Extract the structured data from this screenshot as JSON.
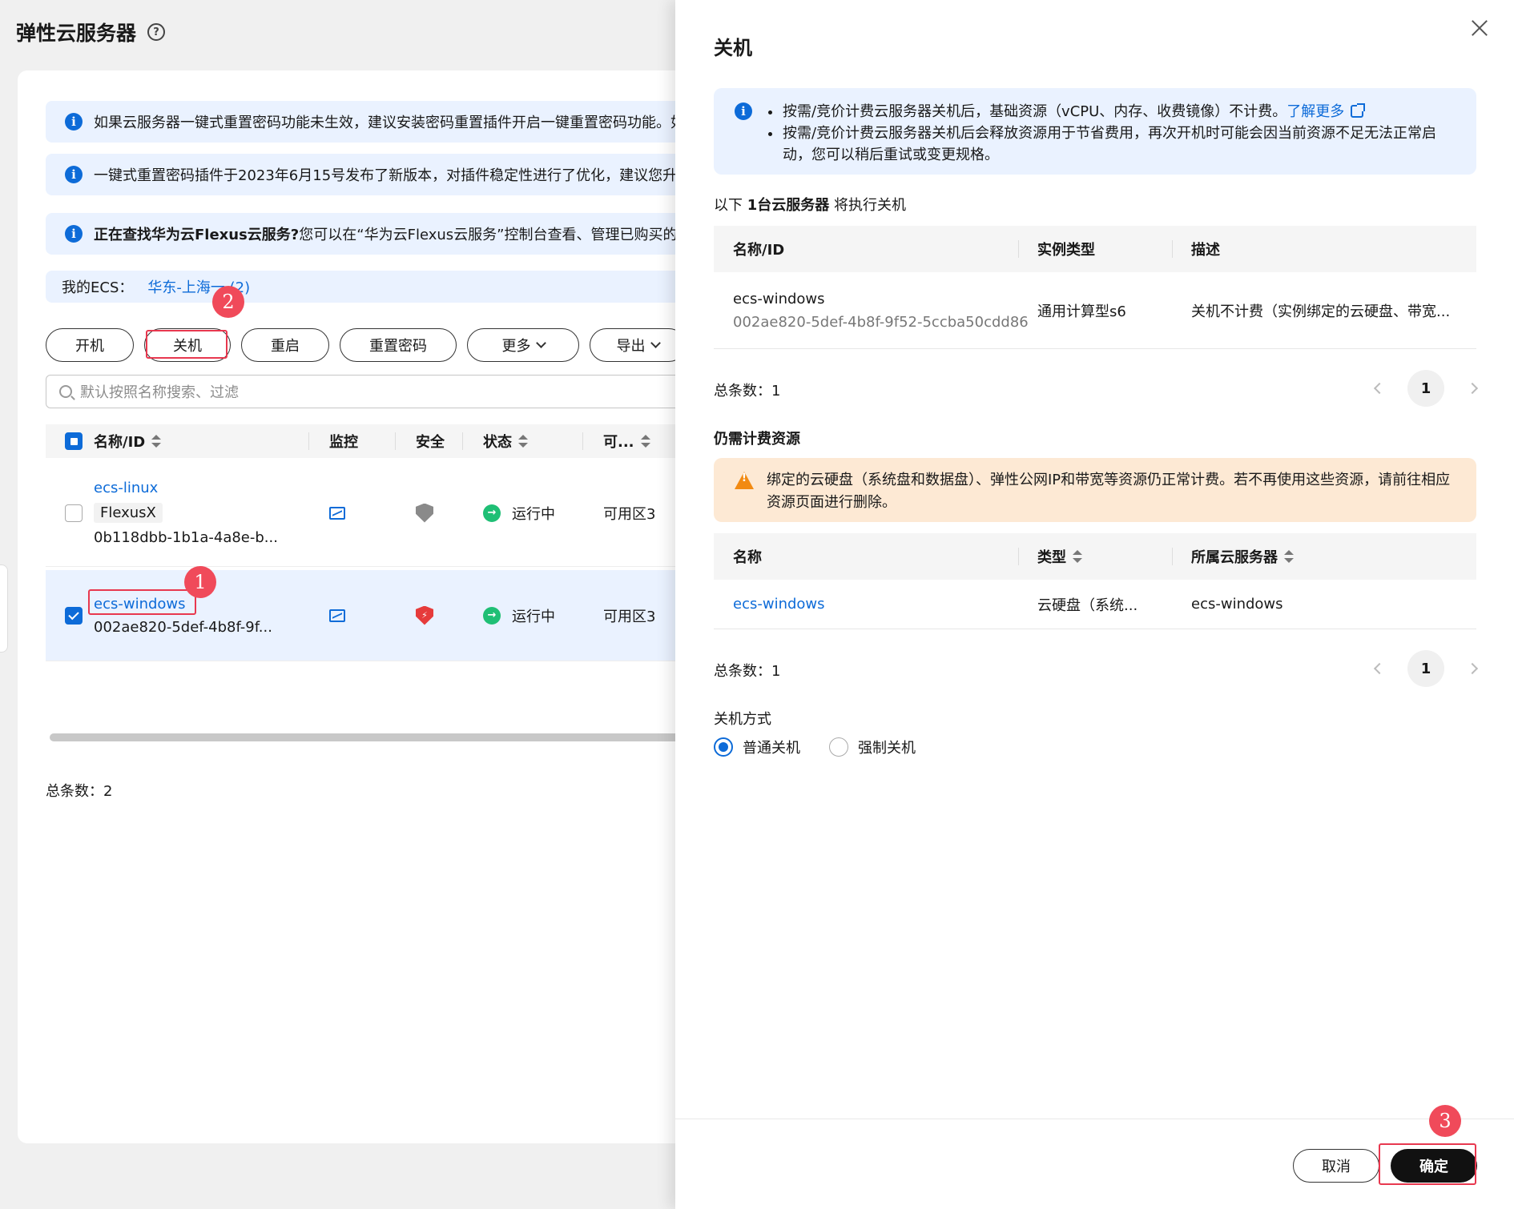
{
  "page": {
    "title": "弹性云服务器",
    "alerts": [
      {
        "text": "如果云服务器一键式重置密码功能未生效，建议安装密码重置插件开启一键重置密码功能。如"
      },
      {
        "text": "一键式重置密码插件于2023年6月15号发布了新版本，对插件稳定性进行了优化，建议您升级"
      },
      {
        "bold": "正在查找华为云Flexus云服务?",
        "text": " 您可以在“华为云Flexus云服务”控制台查看、管理已购买的L"
      }
    ],
    "region": {
      "label": "我的ECS：",
      "value": "华东-上海一 (2)"
    },
    "toolbar": {
      "start": "开机",
      "stop": "关机",
      "restart": "重启",
      "reset_pwd": "重置密码",
      "more": "更多",
      "export": "导出"
    },
    "search": {
      "placeholder": "默认按照名称搜索、过滤"
    },
    "columns": {
      "name": "名称/ID",
      "monitor": "监控",
      "security": "安全",
      "status": "状态",
      "az": "可..."
    },
    "rows": [
      {
        "name": "ecs-linux",
        "tag": "FlexusX",
        "id": "0b118dbb-1b1a-4a8e-b...",
        "status": "运行中",
        "az": "可用区3"
      },
      {
        "name": "ecs-windows",
        "id": "002ae820-5def-4b8f-9f...",
        "status": "运行中",
        "az": "可用区3"
      }
    ],
    "total": "总条数：2"
  },
  "drawer": {
    "title": "关机",
    "info_items": [
      {
        "text": "按需/竞价计费云服务器关机后，基础资源（vCPU、内存、收费镜像）不计费。",
        "link": "了解更多"
      },
      {
        "text": "按需/竞价计费云服务器关机后会释放资源用于节省费用，再次开机时可能会因当前资源不足无法正常启动，您可以稍后重试或变更规格。"
      }
    ],
    "summary": {
      "prefix": "以下 ",
      "bold": "1台云服务器",
      "suffix": " 将执行关机"
    },
    "servers_table": {
      "headers": {
        "name": "名称/ID",
        "type": "实例类型",
        "desc": "描述"
      },
      "rows": [
        {
          "name": "ecs-windows",
          "id": "002ae820-5def-4b8f-9f52-5ccba50cdd86",
          "type": "通用计算型s6",
          "desc": "关机不计费（实例绑定的云硬盘、带宽..."
        }
      ],
      "total": "总条数：1",
      "page": "1"
    },
    "billing_title": "仍需计费资源",
    "warning": "绑定的云硬盘（系统盘和数据盘）、弹性公网IP和带宽等资源仍正常计费。若不再使用这些资源，请前往相应资源页面进行删除。",
    "resources_table": {
      "headers": {
        "name": "名称",
        "type": "类型",
        "server": "所属云服务器"
      },
      "rows": [
        {
          "name": "ecs-windows",
          "type": "云硬盘（系统...",
          "server": "ecs-windows"
        }
      ],
      "total": "总条数：1",
      "page": "1"
    },
    "mode": {
      "label": "关机方式",
      "normal": "普通关机",
      "force": "强制关机",
      "selected": "普通关机"
    },
    "footer": {
      "cancel": "取消",
      "ok": "确定"
    }
  },
  "annotations": {
    "one": "1",
    "two": "2",
    "three": "3"
  },
  "colors": {
    "primary": "#0d6bd8",
    "mark": "#e8384f",
    "running": "#1fbf75",
    "warning_bg": "#fde9d4"
  }
}
